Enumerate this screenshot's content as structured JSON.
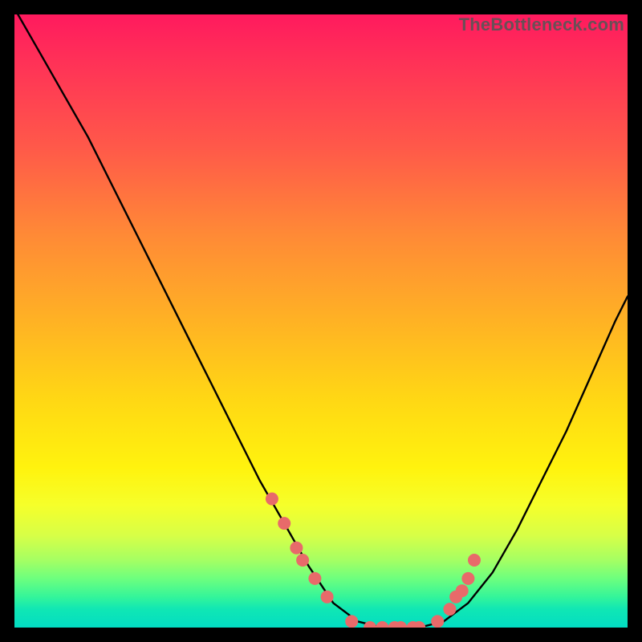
{
  "watermark": "TheBottleneck.com",
  "chart_data": {
    "type": "line",
    "title": "",
    "xlabel": "",
    "ylabel": "",
    "xlim": [
      0,
      100
    ],
    "ylim": [
      0,
      100
    ],
    "curve": {
      "x": [
        0,
        4,
        8,
        12,
        16,
        20,
        24,
        28,
        32,
        36,
        40,
        44,
        48,
        52,
        56,
        60,
        63,
        66,
        70,
        74,
        78,
        82,
        86,
        90,
        94,
        98,
        100
      ],
      "y": [
        101,
        94,
        87,
        80,
        72,
        64,
        56,
        48,
        40,
        32,
        24,
        17,
        10,
        4,
        1,
        0,
        0,
        0,
        1,
        4,
        9,
        16,
        24,
        32,
        41,
        50,
        54
      ]
    },
    "markers": {
      "x": [
        42,
        44,
        46,
        47,
        49,
        51,
        55,
        58,
        60,
        62,
        63,
        65,
        66,
        69,
        71,
        72,
        73,
        74,
        75
      ],
      "y": [
        21,
        17,
        13,
        11,
        8,
        5,
        1,
        0,
        0,
        0,
        0,
        0,
        0,
        1,
        3,
        5,
        6,
        8,
        11
      ]
    }
  }
}
